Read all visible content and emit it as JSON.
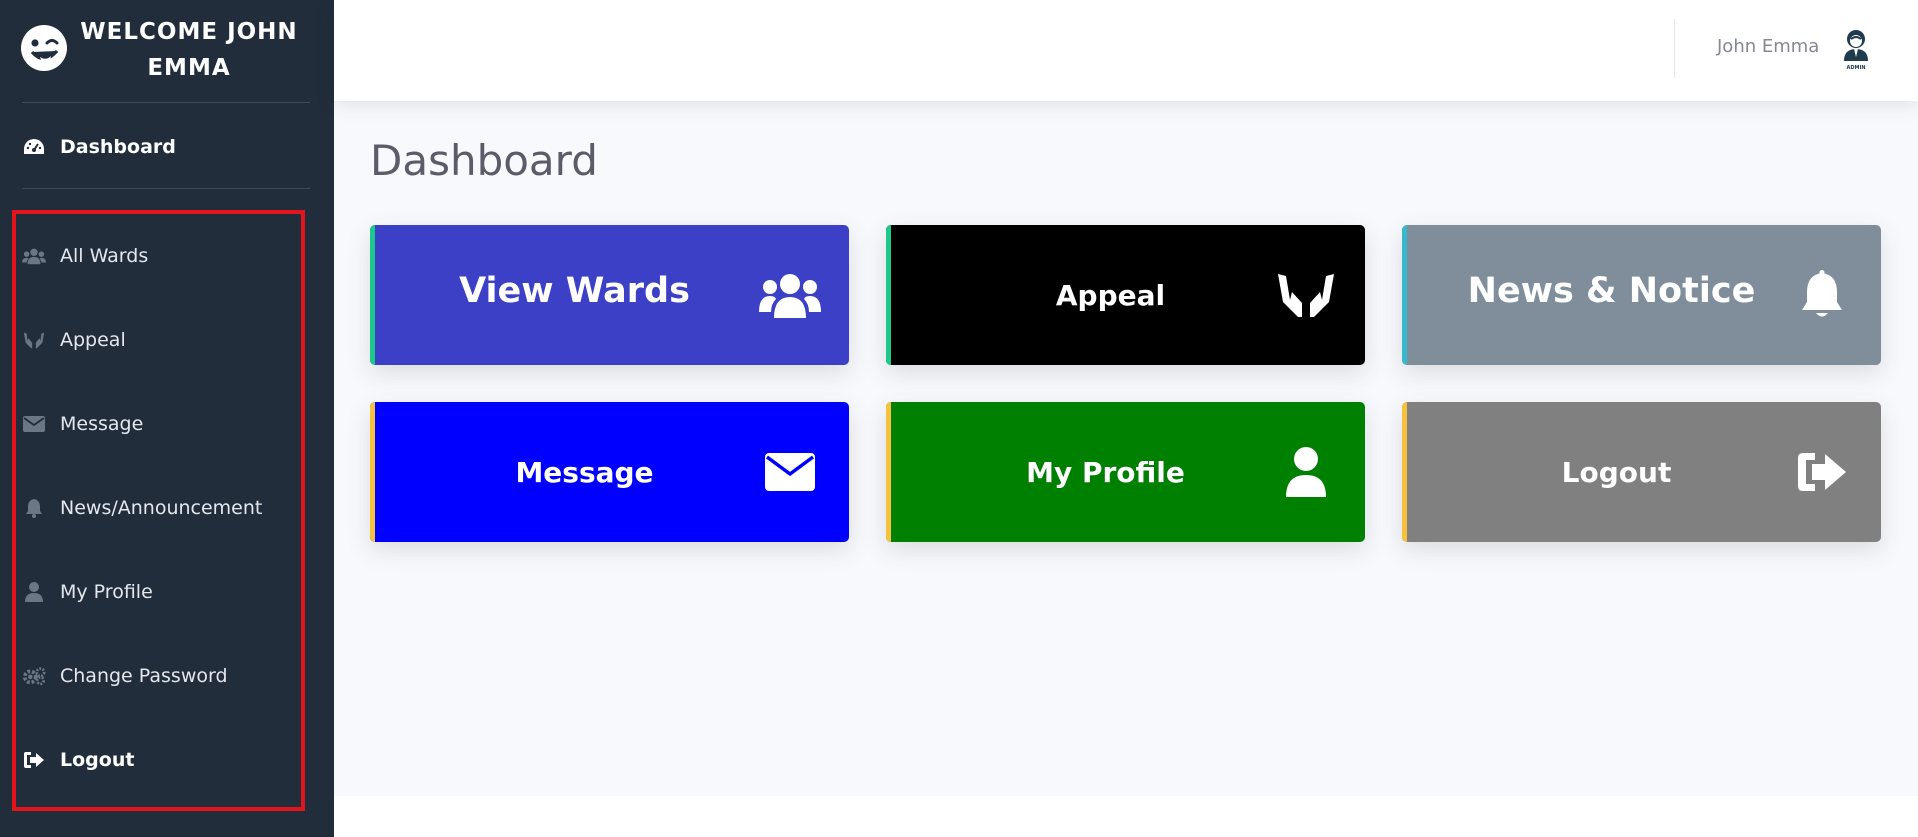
{
  "sidebar": {
    "welcome": "WELCOME JOHN EMMA",
    "dashboard": "Dashboard",
    "items": [
      {
        "label": "All Wards",
        "icon": "users-icon"
      },
      {
        "label": "Appeal",
        "icon": "hands-icon"
      },
      {
        "label": "Message",
        "icon": "envelope-icon"
      },
      {
        "label": "News/Announcement",
        "icon": "bell-icon"
      },
      {
        "label": "My Profile",
        "icon": "user-icon"
      },
      {
        "label": "Change Password",
        "icon": "gears-icon"
      },
      {
        "label": "Logout",
        "icon": "sign-out-icon"
      }
    ]
  },
  "topbar": {
    "user_name": "John Emma",
    "avatar_caption": "ADMIN"
  },
  "main": {
    "title": "Dashboard",
    "cards": [
      {
        "label": "View Wards",
        "bg": "#3c40c6",
        "accent": "#1cc88a",
        "icon": "users-icon"
      },
      {
        "label": "Appeal",
        "bg": "#000000",
        "accent": "#1cc88a",
        "icon": "hands-icon"
      },
      {
        "label": "News & Notice",
        "bg": "#808e9b",
        "accent": "#36b9cc",
        "icon": "bell-icon"
      },
      {
        "label": "Message",
        "bg": "#0000ff",
        "accent": "#f6c23e",
        "icon": "envelope-icon"
      },
      {
        "label": "My Profile",
        "bg": "#008000",
        "accent": "#f6c23e",
        "icon": "user-icon"
      },
      {
        "label": "Logout",
        "bg": "#808080",
        "accent": "#f6c23e",
        "icon": "sign-out-icon"
      }
    ]
  },
  "colors": {
    "sidebar_bg": "#212d3b",
    "highlight": "#e3141b"
  }
}
